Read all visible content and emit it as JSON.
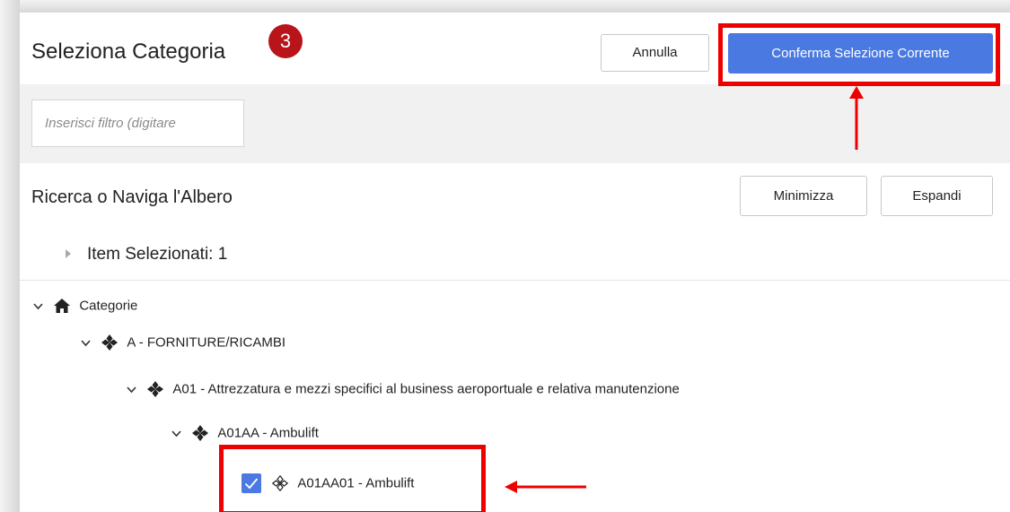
{
  "dialog": {
    "title": "Seleziona Categoria",
    "step_badge": "3",
    "cancel_label": "Annulla",
    "confirm_label": "Conferma Selezione Corrente"
  },
  "filter": {
    "placeholder": "Inserisci filtro (digitare"
  },
  "tree_header": {
    "title": "Ricerca o Naviga l'Albero",
    "minimize_label": "Minimizza",
    "expand_label": "Espandi"
  },
  "selected_items": {
    "label": "Item Selezionati: 1"
  },
  "tree": {
    "nodes": [
      {
        "label": "Categorie",
        "icon": "home-icon",
        "expanded": true
      },
      {
        "label": "A - FORNITURE/RICAMBI",
        "icon": "diamond-cluster-icon",
        "expanded": true
      },
      {
        "label": "A01 - Attrezzatura e mezzi specifici al business aeroportuale e relativa manutenzione",
        "icon": "diamond-cluster-icon",
        "expanded": true
      },
      {
        "label": "A01AA - Ambulift",
        "icon": "diamond-cluster-icon",
        "expanded": true
      },
      {
        "label": "A01AA01 - Ambulift",
        "icon": "diamond-outline-icon",
        "checked": true
      }
    ]
  },
  "colors": {
    "primary": "#4a79e1",
    "badge": "#b8141a",
    "annotation": "#ee0000"
  }
}
